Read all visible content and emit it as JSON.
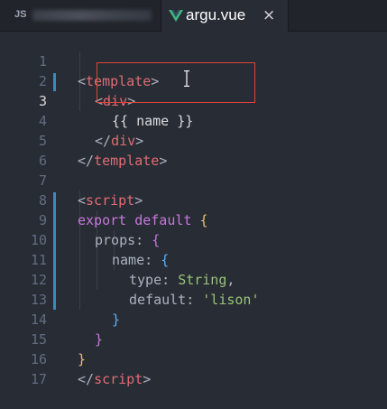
{
  "tabs": [
    {
      "prefix": "JS",
      "label": "",
      "active": false
    },
    {
      "label": "argu.vue",
      "close": "×",
      "active": true
    }
  ],
  "editor": {
    "lines": [
      {
        "n": "1"
      },
      {
        "n": "2"
      },
      {
        "n": "3"
      },
      {
        "n": "4"
      },
      {
        "n": "5"
      },
      {
        "n": "6"
      },
      {
        "n": "7"
      },
      {
        "n": "8"
      },
      {
        "n": "9"
      },
      {
        "n": "10"
      },
      {
        "n": "11"
      },
      {
        "n": "12"
      },
      {
        "n": "13"
      },
      {
        "n": "14"
      },
      {
        "n": "15"
      },
      {
        "n": "16"
      },
      {
        "n": "17"
      }
    ],
    "active_line": "3",
    "code": {
      "l1": {
        "open": "<",
        "tag": "template",
        "close": ">"
      },
      "l2": {
        "open": "<",
        "tag": "div",
        "close": ">"
      },
      "l3": {
        "text": "{{ name }}"
      },
      "l4": {
        "open": "</",
        "tag": "div",
        "close": ">"
      },
      "l5": {
        "open": "</",
        "tag": "template",
        "close": ">"
      },
      "l7": {
        "open": "<",
        "tag": "script",
        "close": ">"
      },
      "l8": {
        "kw": "export default",
        "brace": "{"
      },
      "l9": {
        "key": "props",
        "colon": ":",
        "brace": "{"
      },
      "l10": {
        "key": "name",
        "colon": ":",
        "brace": "{"
      },
      "l11": {
        "key": "type",
        "colon": ":",
        "value": "String",
        "comma": ","
      },
      "l12": {
        "key": "default",
        "colon": ":",
        "value": "'lison'"
      },
      "l13": {
        "brace": "}"
      },
      "l14": {
        "brace": "}"
      },
      "l15": {
        "brace": "}"
      },
      "l16": {
        "open": "</",
        "tag": "script",
        "close": ">"
      }
    }
  },
  "colors": {
    "background": "#282c34",
    "tag": "#e06c75",
    "keyword": "#c678dd",
    "string": "#98c379",
    "highlight_box": "#e0443a",
    "modified_gutter": "#3a8bb8"
  }
}
